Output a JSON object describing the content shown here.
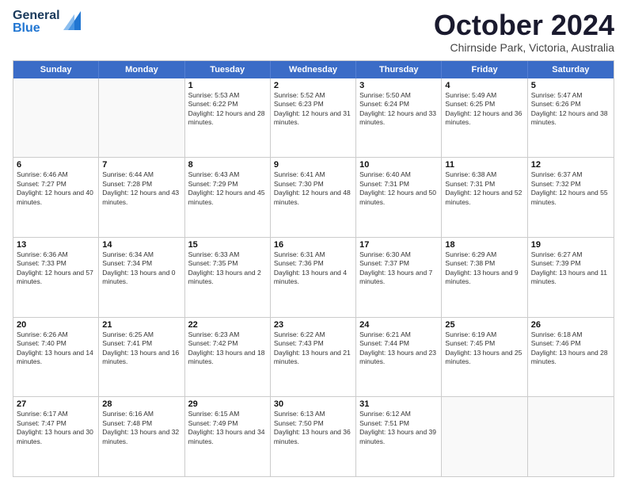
{
  "header": {
    "logo_text1": "General",
    "logo_text2": "Blue",
    "month": "October 2024",
    "location": "Chirnside Park, Victoria, Australia"
  },
  "weekdays": [
    "Sunday",
    "Monday",
    "Tuesday",
    "Wednesday",
    "Thursday",
    "Friday",
    "Saturday"
  ],
  "rows": [
    [
      {
        "day": "",
        "info": ""
      },
      {
        "day": "",
        "info": ""
      },
      {
        "day": "1",
        "info": "Sunrise: 5:53 AM\nSunset: 6:22 PM\nDaylight: 12 hours and 28 minutes."
      },
      {
        "day": "2",
        "info": "Sunrise: 5:52 AM\nSunset: 6:23 PM\nDaylight: 12 hours and 31 minutes."
      },
      {
        "day": "3",
        "info": "Sunrise: 5:50 AM\nSunset: 6:24 PM\nDaylight: 12 hours and 33 minutes."
      },
      {
        "day": "4",
        "info": "Sunrise: 5:49 AM\nSunset: 6:25 PM\nDaylight: 12 hours and 36 minutes."
      },
      {
        "day": "5",
        "info": "Sunrise: 5:47 AM\nSunset: 6:26 PM\nDaylight: 12 hours and 38 minutes."
      }
    ],
    [
      {
        "day": "6",
        "info": "Sunrise: 6:46 AM\nSunset: 7:27 PM\nDaylight: 12 hours and 40 minutes."
      },
      {
        "day": "7",
        "info": "Sunrise: 6:44 AM\nSunset: 7:28 PM\nDaylight: 12 hours and 43 minutes."
      },
      {
        "day": "8",
        "info": "Sunrise: 6:43 AM\nSunset: 7:29 PM\nDaylight: 12 hours and 45 minutes."
      },
      {
        "day": "9",
        "info": "Sunrise: 6:41 AM\nSunset: 7:30 PM\nDaylight: 12 hours and 48 minutes."
      },
      {
        "day": "10",
        "info": "Sunrise: 6:40 AM\nSunset: 7:31 PM\nDaylight: 12 hours and 50 minutes."
      },
      {
        "day": "11",
        "info": "Sunrise: 6:38 AM\nSunset: 7:31 PM\nDaylight: 12 hours and 52 minutes."
      },
      {
        "day": "12",
        "info": "Sunrise: 6:37 AM\nSunset: 7:32 PM\nDaylight: 12 hours and 55 minutes."
      }
    ],
    [
      {
        "day": "13",
        "info": "Sunrise: 6:36 AM\nSunset: 7:33 PM\nDaylight: 12 hours and 57 minutes."
      },
      {
        "day": "14",
        "info": "Sunrise: 6:34 AM\nSunset: 7:34 PM\nDaylight: 13 hours and 0 minutes."
      },
      {
        "day": "15",
        "info": "Sunrise: 6:33 AM\nSunset: 7:35 PM\nDaylight: 13 hours and 2 minutes."
      },
      {
        "day": "16",
        "info": "Sunrise: 6:31 AM\nSunset: 7:36 PM\nDaylight: 13 hours and 4 minutes."
      },
      {
        "day": "17",
        "info": "Sunrise: 6:30 AM\nSunset: 7:37 PM\nDaylight: 13 hours and 7 minutes."
      },
      {
        "day": "18",
        "info": "Sunrise: 6:29 AM\nSunset: 7:38 PM\nDaylight: 13 hours and 9 minutes."
      },
      {
        "day": "19",
        "info": "Sunrise: 6:27 AM\nSunset: 7:39 PM\nDaylight: 13 hours and 11 minutes."
      }
    ],
    [
      {
        "day": "20",
        "info": "Sunrise: 6:26 AM\nSunset: 7:40 PM\nDaylight: 13 hours and 14 minutes."
      },
      {
        "day": "21",
        "info": "Sunrise: 6:25 AM\nSunset: 7:41 PM\nDaylight: 13 hours and 16 minutes."
      },
      {
        "day": "22",
        "info": "Sunrise: 6:23 AM\nSunset: 7:42 PM\nDaylight: 13 hours and 18 minutes."
      },
      {
        "day": "23",
        "info": "Sunrise: 6:22 AM\nSunset: 7:43 PM\nDaylight: 13 hours and 21 minutes."
      },
      {
        "day": "24",
        "info": "Sunrise: 6:21 AM\nSunset: 7:44 PM\nDaylight: 13 hours and 23 minutes."
      },
      {
        "day": "25",
        "info": "Sunrise: 6:19 AM\nSunset: 7:45 PM\nDaylight: 13 hours and 25 minutes."
      },
      {
        "day": "26",
        "info": "Sunrise: 6:18 AM\nSunset: 7:46 PM\nDaylight: 13 hours and 28 minutes."
      }
    ],
    [
      {
        "day": "27",
        "info": "Sunrise: 6:17 AM\nSunset: 7:47 PM\nDaylight: 13 hours and 30 minutes."
      },
      {
        "day": "28",
        "info": "Sunrise: 6:16 AM\nSunset: 7:48 PM\nDaylight: 13 hours and 32 minutes."
      },
      {
        "day": "29",
        "info": "Sunrise: 6:15 AM\nSunset: 7:49 PM\nDaylight: 13 hours and 34 minutes."
      },
      {
        "day": "30",
        "info": "Sunrise: 6:13 AM\nSunset: 7:50 PM\nDaylight: 13 hours and 36 minutes."
      },
      {
        "day": "31",
        "info": "Sunrise: 6:12 AM\nSunset: 7:51 PM\nDaylight: 13 hours and 39 minutes."
      },
      {
        "day": "",
        "info": ""
      },
      {
        "day": "",
        "info": ""
      }
    ]
  ]
}
